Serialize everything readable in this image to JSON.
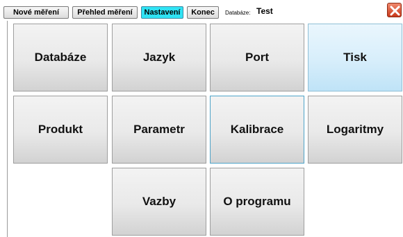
{
  "toolbar": {
    "tabs": [
      {
        "label": "Nové měření"
      },
      {
        "label": "Přehled měření"
      },
      {
        "label": "Nastavení"
      },
      {
        "label": "Konec"
      }
    ],
    "database_label": "Databáze:",
    "database_value": "Test",
    "close_icon": "close-x-icon"
  },
  "colors": {
    "active_tab": "#2fe3f4",
    "tile_highlight": "#d7eefb",
    "close_button": "#d9482a"
  },
  "tiles": [
    {
      "label": "Databáze"
    },
    {
      "label": "Jazyk"
    },
    {
      "label": "Port"
    },
    {
      "label": "Tisk"
    },
    {
      "label": "Produkt"
    },
    {
      "label": "Parametr"
    },
    {
      "label": "Kalibrace"
    },
    {
      "label": "Logaritmy"
    },
    {
      "label": "Vazby"
    },
    {
      "label": "O programu"
    }
  ]
}
